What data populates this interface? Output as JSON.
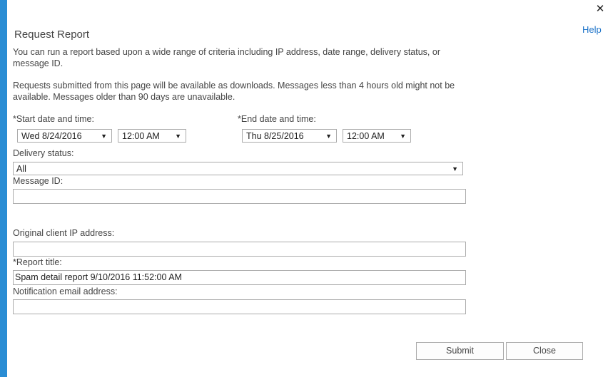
{
  "dialog": {
    "title": "Request Report",
    "help_label": "Help",
    "close_glyph": "✕",
    "intro": "You can run a report based upon a wide range of criteria including IP address, date range, delivery status, or message ID.",
    "note": "Requests submitted from this page will be available as downloads. Messages less than 4 hours old might not be available. Messages older than 90 days are unavailable."
  },
  "start": {
    "label": "*Start date and time:",
    "date": "Wed 8/24/2016",
    "time": "12:00 AM"
  },
  "end": {
    "label": "*End date and time:",
    "date": "Thu 8/25/2016",
    "time": "12:00 AM"
  },
  "delivery_status": {
    "label": "Delivery status:",
    "value": "All"
  },
  "message_id": {
    "label": "Message ID:",
    "value": ""
  },
  "client_ip": {
    "label": "Original client IP address:",
    "value": ""
  },
  "report_title": {
    "label": "*Report title:",
    "value": "Spam detail report 9/10/2016 11:52:00 AM"
  },
  "notification_email": {
    "label": "Notification email address:",
    "value": ""
  },
  "buttons": {
    "submit": "Submit",
    "close": "Close"
  },
  "icons": {
    "dropdown_arrow": "▼"
  },
  "colors": {
    "accent_bar": "#2a8dd4",
    "link": "#1e74c9"
  }
}
